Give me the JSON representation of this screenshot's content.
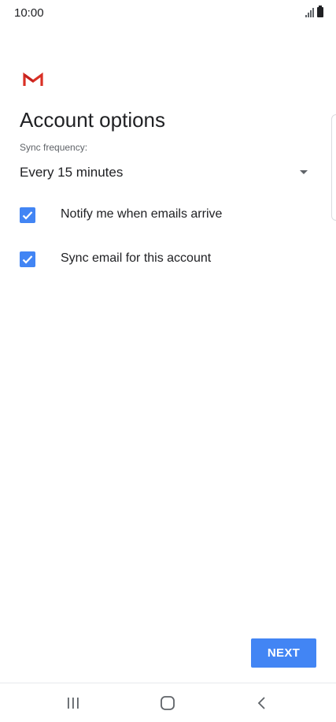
{
  "status_bar": {
    "time": "10:00",
    "signal_icon": "signal-icon",
    "battery_icon": "battery-icon"
  },
  "app": {
    "logo_icon": "gmail-logo-icon",
    "title": "Account options"
  },
  "sync": {
    "label": "Sync frequency:",
    "selected": "Every 15 minutes"
  },
  "options": [
    {
      "label": "Notify me when emails arrive",
      "checked": true
    },
    {
      "label": "Sync email for this account",
      "checked": true
    }
  ],
  "actions": {
    "next_label": "NEXT"
  },
  "nav": {
    "recents_icon": "recents-icon",
    "home_icon": "home-icon",
    "back_icon": "back-icon"
  },
  "colors": {
    "accent": "#4285f4",
    "gmail_red": "#d93025",
    "text": "#202124",
    "secondary_text": "#5f6368"
  }
}
